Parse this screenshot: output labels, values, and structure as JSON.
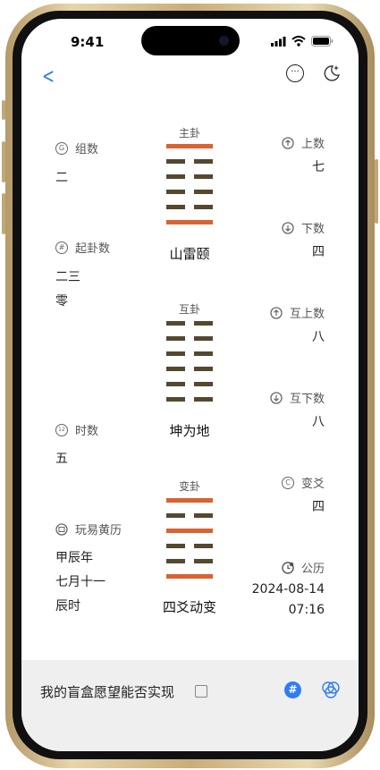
{
  "status": {
    "time": "9:41"
  },
  "nav": {
    "back": "<",
    "more": "···"
  },
  "left": {
    "group": {
      "title": "组数",
      "icon": "G",
      "value": "二"
    },
    "start": {
      "title": "起卦数",
      "icon": "#",
      "values": [
        "二三",
        "零"
      ]
    },
    "hour": {
      "title": "时数",
      "icon": "12",
      "value": "五"
    },
    "calendar": {
      "title": "玩易黄历",
      "values": [
        "甲辰年",
        "七月十一",
        "辰时"
      ]
    }
  },
  "right": {
    "upper": {
      "title": "上数",
      "value": "七"
    },
    "lower": {
      "title": "下数",
      "value": "四"
    },
    "mutual_upper": {
      "title": "互上数",
      "value": "八"
    },
    "mutual_lower": {
      "title": "互下数",
      "value": "八"
    },
    "changing_line": {
      "title": "变爻",
      "icon": "C",
      "value": "四"
    },
    "gregorian": {
      "title": "公历",
      "date": "2024-08-14",
      "time": "07:16"
    }
  },
  "hexagrams": {
    "main": {
      "label": "主卦",
      "name": "山雷颐",
      "lines_top_to_bottom": [
        "yang",
        "yin",
        "yin",
        "yin",
        "yin",
        "yang"
      ]
    },
    "mutual": {
      "label": "互卦",
      "name": "坤为地",
      "lines_top_to_bottom": [
        "yin",
        "yin",
        "yin",
        "yin",
        "yin",
        "yin"
      ]
    },
    "changed": {
      "label": "变卦",
      "name": "四爻动变",
      "lines_top_to_bottom": [
        "yang",
        "yin",
        "yang",
        "yin",
        "yin",
        "yang"
      ]
    }
  },
  "bottom": {
    "question": "我的盲盒愿望能否实现",
    "tag_icon": "#"
  },
  "colors": {
    "yang": "#d86333",
    "yin": "#554830",
    "accent": "#2f7cf6"
  }
}
